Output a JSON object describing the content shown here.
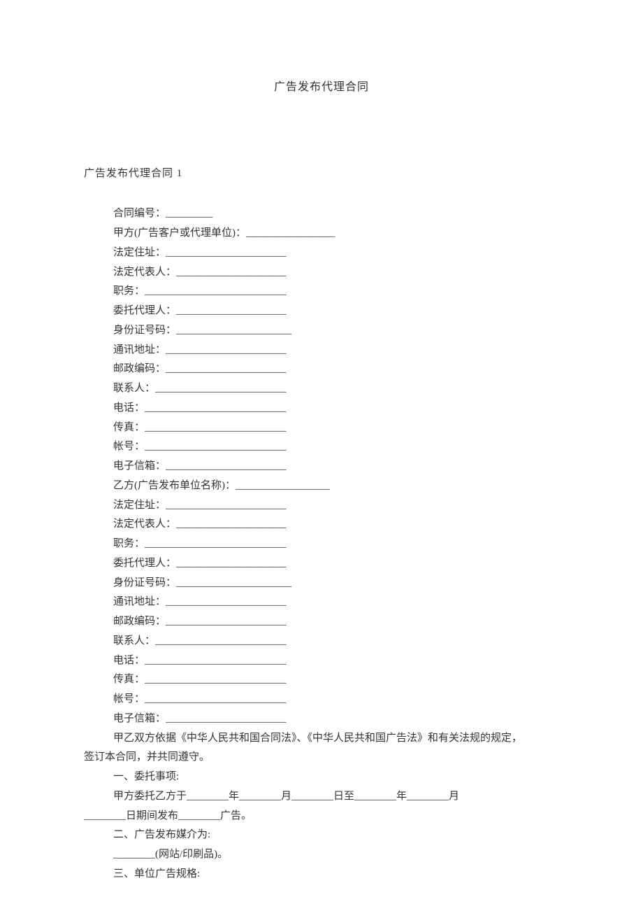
{
  "title": "广告发布代理合同",
  "section_head": "广告发布代理合同 1",
  "lines": {
    "l0": "合同编号：_________",
    "l1": "甲方(广告客户或代理单位)：_________________",
    "l2": "法定住址：_______________________",
    "l3": "法定代表人：_____________________",
    "l4": "职务：___________________________",
    "l5": "委托代理人：_____________________",
    "l6": "身份证号码：______________________",
    "l7": "通讯地址：_______________________",
    "l8": "邮政编码：_______________________",
    "l9": "联系人：_________________________",
    "l10": "电话：___________________________",
    "l11": "传真：___________________________",
    "l12": "帐号：___________________________",
    "l13": "电子信箱：_______________________",
    "l14": "乙方(广告发布单位名称)：__________________",
    "l15": "法定住址：_______________________",
    "l16": "法定代表人：_____________________",
    "l17": "职务：___________________________",
    "l18": "委托代理人：_____________________",
    "l19": "身份证号码：______________________",
    "l20": "通讯地址：_______________________",
    "l21": "邮政编码：_______________________",
    "l22": "联系人：_________________________",
    "l23": "电话：___________________________",
    "l24": "传真：___________________________",
    "l25": "帐号：___________________________",
    "l26": "电子信箱：_______________________"
  },
  "para1a": "甲乙双方依据《中华人民共和国合同法》、《中华人民共和国广告法》和有关法规的规定，",
  "para1b": "签订本合同，并共同遵守。",
  "para2": "一、委托事项:",
  "para3a": "甲方委托乙方于________年________月________日至________年________月",
  "para3b": "________日期间发布________广告。",
  "para4": "二、广告发布媒介为:",
  "para5": "________(网站/印刷品)。",
  "para6": "三、单位广告规格:"
}
